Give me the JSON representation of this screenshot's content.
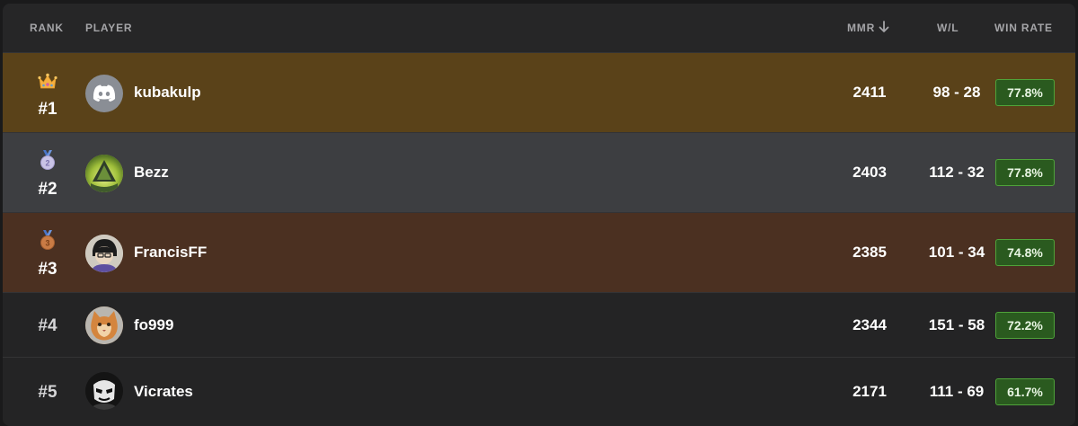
{
  "header": {
    "rank": "RANK",
    "player": "PLAYER",
    "mmr": "MMR",
    "wl": "W/L",
    "win_rate": "WIN RATE"
  },
  "rows": [
    {
      "rank": "#1",
      "medal": "crown-icon",
      "name": "kubakulp",
      "mmr": "2411",
      "wl": "98 - 28",
      "win_rate": "77.8%"
    },
    {
      "rank": "#2",
      "medal": "silver-medal-icon",
      "medal_text": "2",
      "name": "Bezz",
      "mmr": "2403",
      "wl": "112 - 32",
      "win_rate": "77.8%"
    },
    {
      "rank": "#3",
      "medal": "bronze-medal-icon",
      "medal_text": "3",
      "name": "FrancisFF",
      "mmr": "2385",
      "wl": "101 - 34",
      "win_rate": "74.8%"
    },
    {
      "rank": "#4",
      "name": "fo999",
      "mmr": "2344",
      "wl": "151 - 58",
      "win_rate": "72.2%"
    },
    {
      "rank": "#5",
      "name": "Vicrates",
      "mmr": "2171",
      "wl": "111 - 69",
      "win_rate": "61.7%"
    }
  ],
  "colors": {
    "gold_row": "#5a4219",
    "silver_row": "#3d3e41",
    "bronze_row": "#4b3021",
    "winrate_bg": "#2a5a1f",
    "winrate_border": "#4fa33a"
  }
}
